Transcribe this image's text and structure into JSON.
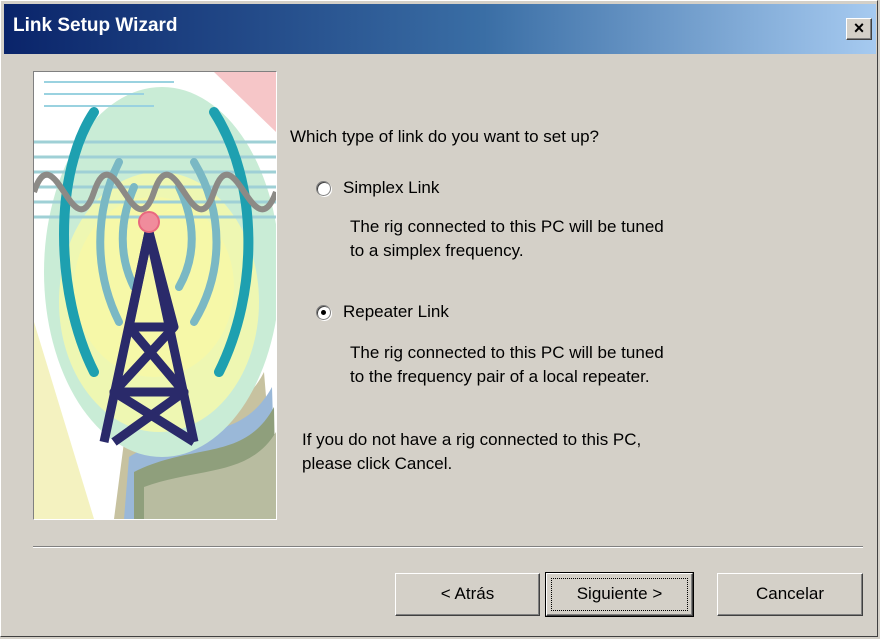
{
  "window": {
    "title": "Link Setup Wizard",
    "close_label": "×"
  },
  "content": {
    "question": "Which type of link do you want to set up?",
    "options": [
      {
        "label": "Simplex Link",
        "selected": false,
        "description_lines": [
          "The rig connected to this PC will be tuned",
          "to a simplex frequency."
        ]
      },
      {
        "label": "Repeater Link",
        "selected": true,
        "description_lines": [
          "The rig connected to this PC will be tuned",
          "to the frequency pair of a local repeater."
        ]
      }
    ],
    "note_lines": [
      "If you do not have a rig connected to this PC,",
      "please click Cancel."
    ]
  },
  "buttons": {
    "back": "< Atrás",
    "next": "Siguiente >",
    "cancel": "Cancelar"
  },
  "colors": {
    "title_start": "#0a246a",
    "title_end": "#a6caf0",
    "face": "#d4d0c8"
  },
  "icons": {
    "wizard_image": "radio-tower-illustration",
    "close": "close-icon"
  }
}
